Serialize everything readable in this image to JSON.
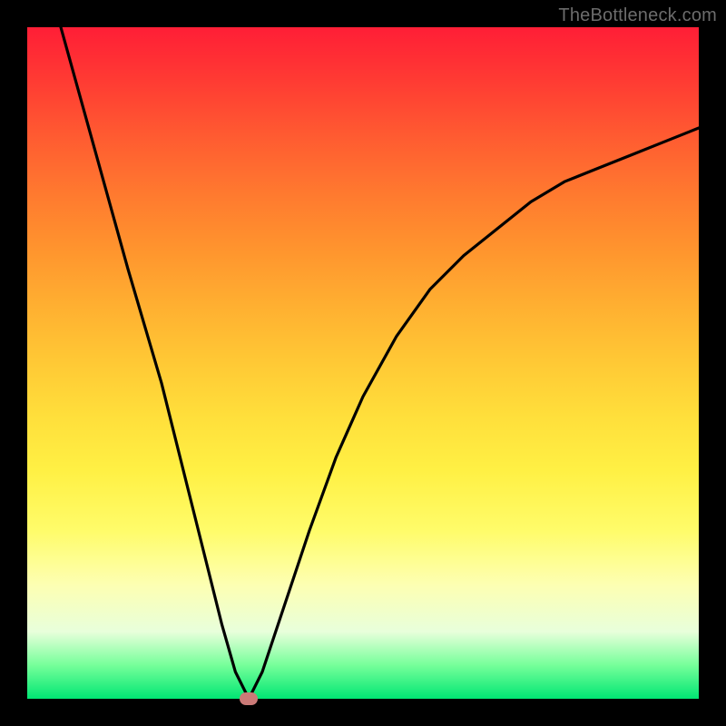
{
  "watermark": "TheBottleneck.com",
  "chart_data": {
    "type": "line",
    "title": "",
    "xlabel": "",
    "ylabel": "",
    "xlim": [
      0,
      100
    ],
    "ylim": [
      0,
      100
    ],
    "grid": false,
    "legend": false,
    "annotations": [],
    "series": [
      {
        "name": "curve",
        "x": [
          5,
          10,
          15,
          20,
          24,
          27,
          29,
          31,
          33,
          35,
          38,
          42,
          46,
          50,
          55,
          60,
          65,
          70,
          75,
          80,
          85,
          90,
          95,
          100
        ],
        "y": [
          100,
          82,
          64,
          47,
          31,
          19,
          11,
          4,
          0,
          4,
          13,
          25,
          36,
          45,
          54,
          61,
          66,
          70,
          74,
          77,
          79,
          81,
          83,
          85
        ]
      }
    ],
    "marker": {
      "x": 33,
      "y": 0,
      "color": "#cb7a77"
    },
    "background_gradient": {
      "top": "#ff1e36",
      "middle": "#ffe53f",
      "bottom": "#00e673"
    }
  }
}
